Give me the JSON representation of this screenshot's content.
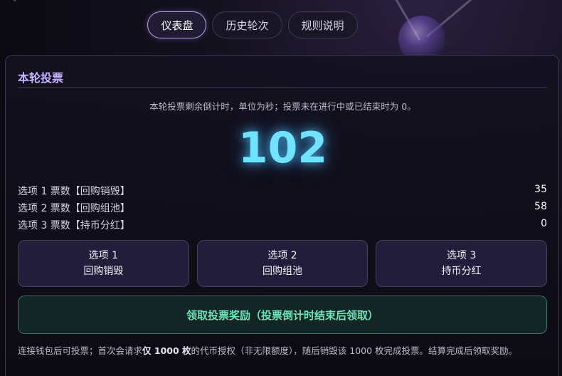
{
  "tabs": [
    {
      "label": "仪表盘",
      "active": true
    },
    {
      "label": "历史轮次",
      "active": false
    },
    {
      "label": "规则说明",
      "active": false
    }
  ],
  "panel": {
    "title": "本轮投票",
    "hint": "本轮投票剩余倒计时，单位为秒；投票未在进行中或已结束时为 0。",
    "countdown": "102",
    "tallies": [
      {
        "label": "选项 1 票数【回购销毁】",
        "count": "35"
      },
      {
        "label": "选项 2 票数【回购组池】",
        "count": "58"
      },
      {
        "label": "选项 3 票数【持币分红】",
        "count": "0"
      }
    ],
    "vote_buttons": [
      {
        "line1": "选项 1",
        "line2": "回购销毁"
      },
      {
        "line1": "选项 2",
        "line2": "回购组池"
      },
      {
        "line1": "选项 3",
        "line2": "持币分红"
      }
    ],
    "claim_label": "领取投票奖励（投票倒计时结束后领取）",
    "footnote": {
      "part1": "连接钱包后可投票；首次会请求",
      "bold": "仅 1000 枚",
      "part2": "的代币授权（非无限额度），随后销毁该 1000 枚完成投票。结算完成后领取奖励。"
    }
  },
  "colors": {
    "accent_purple": "#c7b3ff",
    "countdown_cyan": "#6fe3ff",
    "claim_green": "#6fe3b9"
  }
}
